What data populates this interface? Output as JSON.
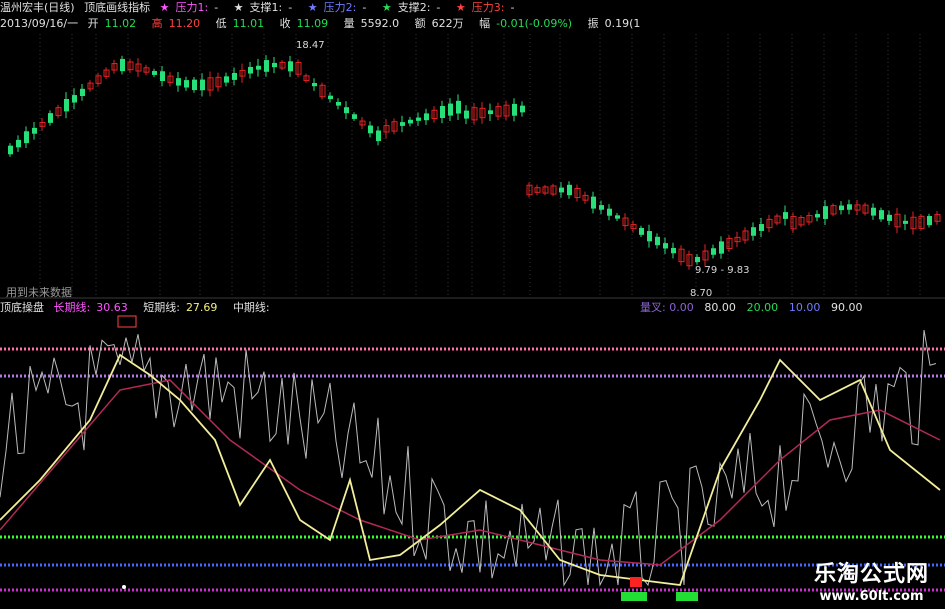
{
  "header": {
    "title": "温州宏丰(日线)",
    "indicator_name": "顶底画线指标",
    "legend": [
      {
        "symbol": "★",
        "label": "压力1:",
        "value": "-",
        "color": "#ff55ff"
      },
      {
        "symbol": "★",
        "label": "支撑1:",
        "value": "-",
        "color": "#e0e0e0"
      },
      {
        "symbol": "★",
        "label": "压力2:",
        "value": "-",
        "color": "#6f7cff"
      },
      {
        "symbol": "★",
        "label": "支撑2:",
        "value": "-",
        "color": "#22dd55"
      },
      {
        "symbol": "★",
        "label": "压力3:",
        "value": "-",
        "color": "#ff4040"
      }
    ]
  },
  "quote": {
    "date": "2013/09/16/一",
    "open_label": "开",
    "open": "11.02",
    "high_label": "高",
    "high": "11.20",
    "low_label": "低",
    "low": "11.01",
    "close_label": "收",
    "close": "11.09",
    "volume_label": "量",
    "volume": "5592.0",
    "amount_label": "额",
    "amount": "622万",
    "change_label": "幅",
    "change": "-0.01(-0.09%)",
    "extra_label": "振",
    "extra": "0.19(1"
  },
  "price_panel": {
    "annotations": {
      "high_mark": "18.47",
      "low_mark": "8.70",
      "range_mark": "9.79 - 9.83"
    },
    "future_data_note": "用到未来数据"
  },
  "indicator_panel": {
    "name": "顶底操盘",
    "long_label": "长期线:",
    "long_value": "30.63",
    "short_label": "短期线:",
    "short_value": "27.69",
    "mid_label": "中期线:",
    "stats_label": "量叉:",
    "stats_values": [
      "0.00",
      "80.00",
      "20.00",
      "10.00",
      "90.00"
    ],
    "level_colors": {
      "top": "#ff6fa8",
      "upper": "#b07be0",
      "support": "#33ff33",
      "low": "#4466ff",
      "bottom": "#cc33cc"
    }
  },
  "watermark": {
    "title": "乐淘公式网",
    "url": "www.60lt.com"
  },
  "colors": {
    "up_candle": "#e02424",
    "down_candle": "#28e07a",
    "short_line": "#f2ee99",
    "long_line": "#b02a55",
    "raw_line": "#bbbbbb"
  }
}
